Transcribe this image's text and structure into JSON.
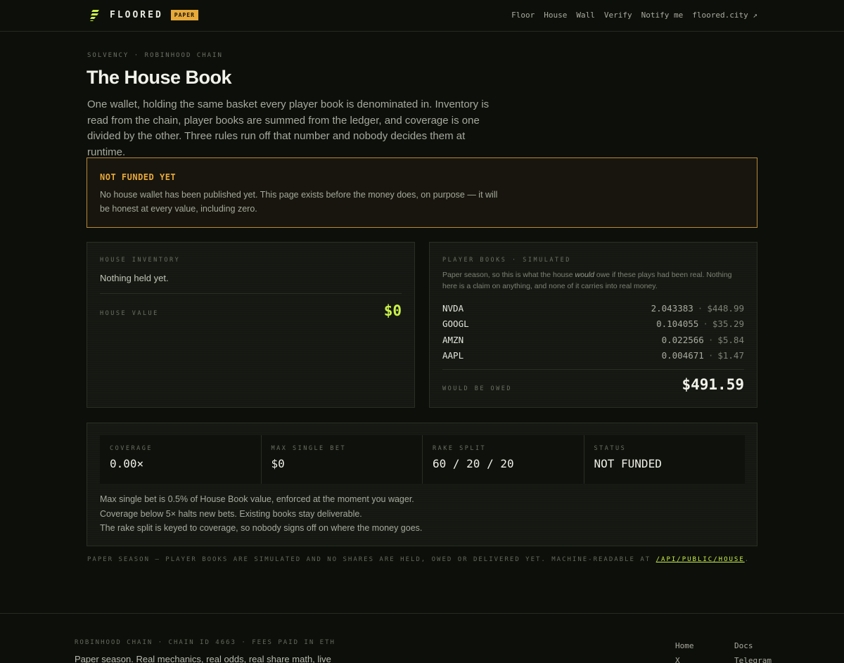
{
  "header": {
    "brand": "FLOORED",
    "badge": "PAPER",
    "nav": [
      "Floor",
      "House",
      "Wall",
      "Verify",
      "Notify me",
      "floored.city ↗"
    ]
  },
  "hero": {
    "eyebrow": "SOLVENCY · ROBINHOOD CHAIN",
    "title": "The House Book",
    "lede": "One wallet, holding the same basket every player book is denominated in. Inventory is read from the chain, player books are summed from the ledger, and coverage is one divided by the other. Three rules run off that number and nobody decides them at runtime."
  },
  "alert": {
    "title": "NOT FUNDED YET",
    "body": "No house wallet has been published yet. This page exists before the money does, on purpose — it will be honest at every value, including zero."
  },
  "inventory": {
    "label": "HOUSE INVENTORY",
    "empty": "Nothing held yet.",
    "value_label": "HOUSE VALUE",
    "value": "$0"
  },
  "books": {
    "label": "PLAYER BOOKS · SIMULATED",
    "desc_before": "Paper season, so this is what the house ",
    "desc_em": "would",
    "desc_after": " owe if these plays had been real. Nothing here is a claim on anything, and none of it carries into real money.",
    "rows": [
      {
        "symbol": "NVDA",
        "qty": "2.043383",
        "usd": "$448.99"
      },
      {
        "symbol": "GOOGL",
        "qty": "0.104055",
        "usd": "$35.29"
      },
      {
        "symbol": "AMZN",
        "qty": "0.022566",
        "usd": "$5.84"
      },
      {
        "symbol": "AAPL",
        "qty": "0.004671",
        "usd": "$1.47"
      }
    ],
    "owed_label": "WOULD BE OWED",
    "owed": "$491.59"
  },
  "stats": {
    "items": [
      {
        "label": "COVERAGE",
        "value": "0.00×"
      },
      {
        "label": "MAX SINGLE BET",
        "value": "$0"
      },
      {
        "label": "RAKE SPLIT",
        "value": "60 / 20 / 20"
      },
      {
        "label": "STATUS",
        "value": "NOT FUNDED"
      }
    ],
    "rules": [
      "Max single bet is 0.5% of House Book value, enforced at the moment you wager.",
      "Coverage below 5× halts new bets. Existing books stay deliverable.",
      "The rake split is keyed to coverage, so nobody signs off on where the money goes."
    ]
  },
  "footnote": {
    "text": "PAPER SEASON — PLAYER BOOKS ARE SIMULATED AND NO SHARES ARE HELD, OWED OR DELIVERED YET. MACHINE-READABLE AT ",
    "link": "/API/PUBLIC/HOUSE",
    "end": "."
  },
  "footer": {
    "caption": "ROBINHOOD CHAIN · CHAIN ID 4663 · FEES PAID IN ETH",
    "line": "Paper season. Real mechanics, real odds, real share math, live",
    "links_col1": [
      "Home",
      "X"
    ],
    "links_col2": [
      "Docs",
      "Telegram"
    ]
  },
  "colors": {
    "accent": "#c9f04a",
    "warning": "#e8a93a",
    "background": "#0d0f0a"
  }
}
